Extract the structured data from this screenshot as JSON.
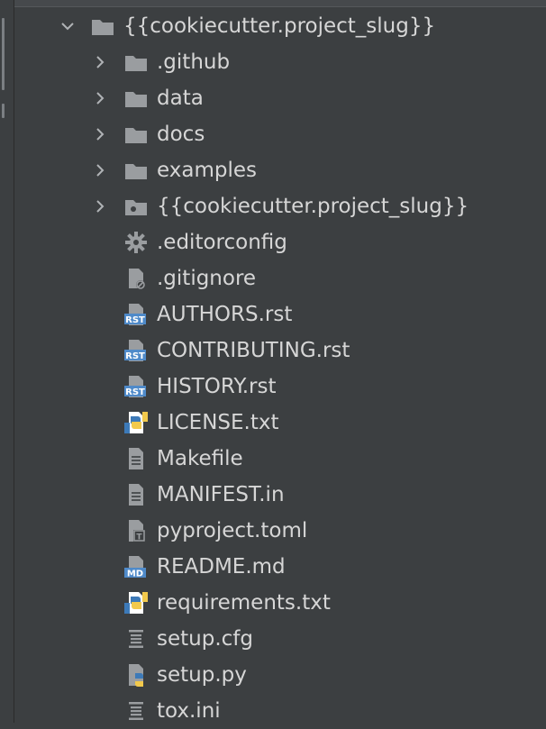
{
  "root": {
    "label": "{{cookiecutter.project_slug}}",
    "expanded": true,
    "icon": "folder-icon"
  },
  "items": [
    {
      "label": ".github",
      "kind": "folder",
      "icon": "folder-icon"
    },
    {
      "label": "data",
      "kind": "folder",
      "icon": "folder-icon"
    },
    {
      "label": "docs",
      "kind": "folder",
      "icon": "folder-icon"
    },
    {
      "label": "examples",
      "kind": "folder",
      "icon": "folder-icon"
    },
    {
      "label": "{{cookiecutter.project_slug}}",
      "kind": "folder",
      "icon": "package-folder-icon"
    },
    {
      "label": ".editorconfig",
      "kind": "file",
      "icon": "gear-icon"
    },
    {
      "label": ".gitignore",
      "kind": "file",
      "icon": "ignore-file-icon"
    },
    {
      "label": "AUTHORS.rst",
      "kind": "file",
      "icon": "rst-file-icon"
    },
    {
      "label": "CONTRIBUTING.rst",
      "kind": "file",
      "icon": "rst-file-icon"
    },
    {
      "label": "HISTORY.rst",
      "kind": "file",
      "icon": "rst-file-icon"
    },
    {
      "label": "LICENSE.txt",
      "kind": "file",
      "icon": "python-text-file-icon"
    },
    {
      "label": "Makefile",
      "kind": "file",
      "icon": "text-file-icon"
    },
    {
      "label": "MANIFEST.in",
      "kind": "file",
      "icon": "text-file-icon"
    },
    {
      "label": "pyproject.toml",
      "kind": "file",
      "icon": "toml-file-icon"
    },
    {
      "label": "README.md",
      "kind": "file",
      "icon": "markdown-file-icon"
    },
    {
      "label": "requirements.txt",
      "kind": "file",
      "icon": "python-text-file-icon"
    },
    {
      "label": "setup.cfg",
      "kind": "file",
      "icon": "config-file-icon"
    },
    {
      "label": "setup.py",
      "kind": "file",
      "icon": "python-file-icon"
    },
    {
      "label": "tox.ini",
      "kind": "file",
      "icon": "config-file-icon"
    }
  ],
  "icon_text": {
    "rst": "RST",
    "md": "MD",
    "toml": "T"
  },
  "colors": {
    "background": "#3c3f41",
    "text": "#d6d6d6",
    "icon_gray": "#9a9da0",
    "icon_blue": "#4f8ac9",
    "python_blue": "#3d7ab8",
    "python_yellow": "#f2c94c"
  }
}
